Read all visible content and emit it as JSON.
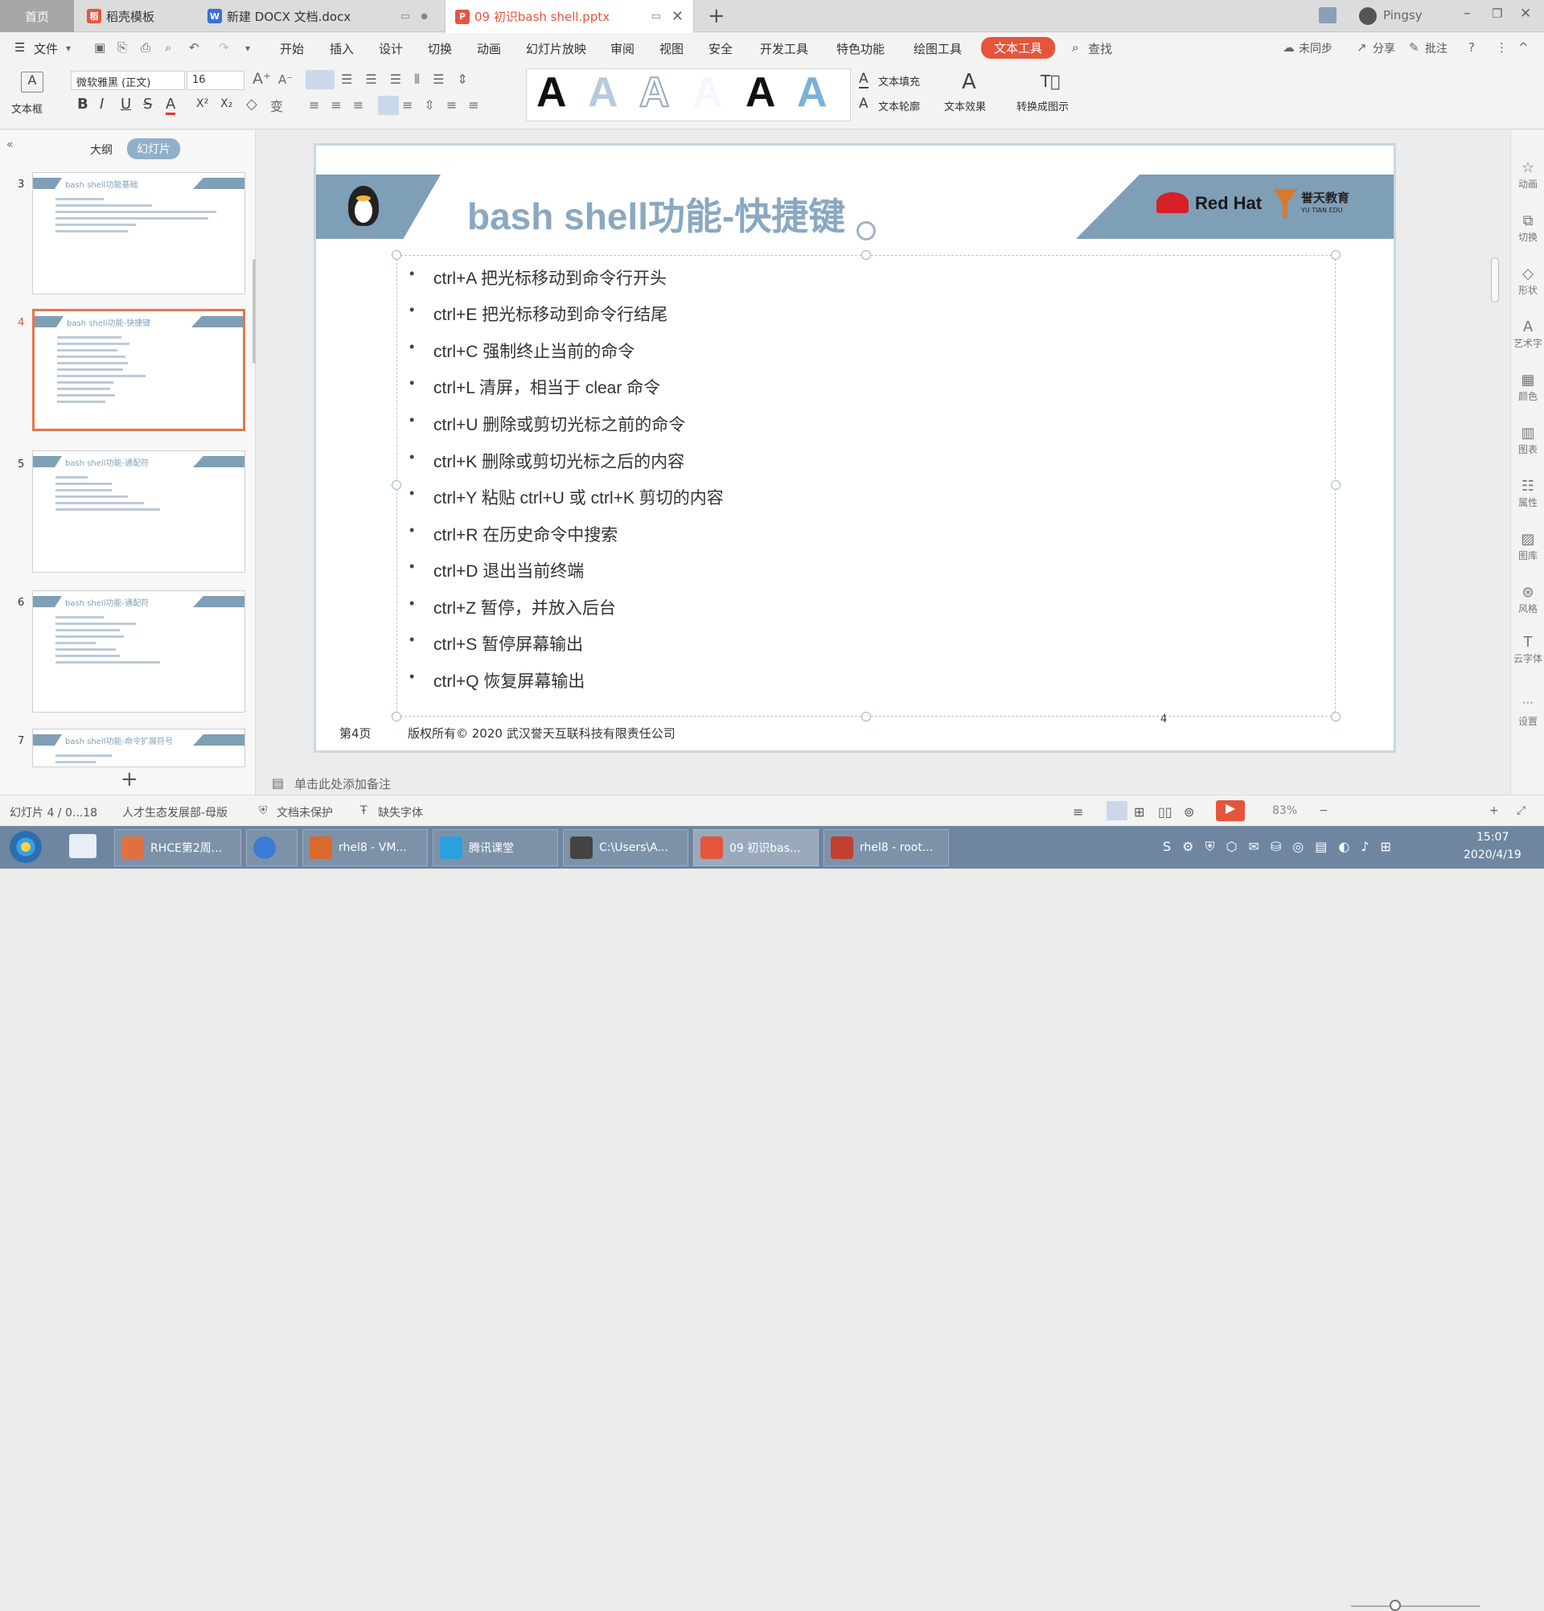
{
  "tabs": {
    "home": "首页",
    "items": [
      {
        "label": "稻壳模板",
        "color": "#e5553c",
        "icon": "docer-icon"
      },
      {
        "label": "新建 DOCX 文档.docx",
        "color": "#3a6fd8",
        "icon": "writer-icon"
      },
      {
        "label": "09 初识bash shell.pptx",
        "color": "#e5553c",
        "icon": "presentation-icon"
      }
    ],
    "user": "Pingsy"
  },
  "menu": {
    "file": "文件",
    "items": [
      "开始",
      "插入",
      "设计",
      "切换",
      "动画",
      "幻灯片放映",
      "审阅",
      "视图",
      "安全",
      "开发工具",
      "特色功能",
      "绘图工具"
    ],
    "active": "文本工具",
    "search": "查找",
    "right": [
      "未同步",
      "分享",
      "批注"
    ]
  },
  "ribbon": {
    "textbox": "文本框",
    "font_name": "微软雅黑 (正文)",
    "font_size": "16",
    "text_fill": "文本填充",
    "text_outline": "文本轮廓",
    "text_effect": "文本效果",
    "convert": "转换成图示",
    "style_letter": "A",
    "format_buttons": [
      "B",
      "I",
      "U",
      "S",
      "A",
      "X²",
      "X₂"
    ]
  },
  "leftpanel": {
    "outline_tab": "大纲",
    "slides_tab": "幻灯片",
    "thumbs": [
      {
        "num": "3",
        "title": "bash shell功能基础"
      },
      {
        "num": "4",
        "title": "bash shell功能-快捷键"
      },
      {
        "num": "5",
        "title": "bash shell功能-通配符"
      },
      {
        "num": "6",
        "title": "bash shell功能-通配符"
      },
      {
        "num": "7",
        "title": "bash shell功能-命令扩展符号"
      }
    ],
    "add": "+"
  },
  "slide": {
    "title": "bash shell功能-快捷键",
    "brand": "Red Hat",
    "partner": "誉天教育",
    "partner_en": "YU TIAN EDU",
    "bullets": [
      "ctrl+A 把光标移动到命令行开头",
      "ctrl+E 把光标移动到命令行结尾",
      "ctrl+C 强制终止当前的命令",
      "ctrl+L 清屏，相当于 clear 命令",
      "ctrl+U 删除或剪切光标之前的命令",
      "ctrl+K 删除或剪切光标之后的内容",
      "ctrl+Y 粘贴 ctrl+U 或 ctrl+K 剪切的内容",
      "ctrl+R 在历史命令中搜索",
      "ctrl+D 退出当前终端",
      "ctrl+Z 暂停，并放入后台",
      "ctrl+S 暂停屏幕输出",
      "ctrl+Q 恢复屏幕输出"
    ],
    "page_label": "第4页",
    "copyright": "版权所有© 2020 武汉誉天互联科技有限责任公司",
    "page_num": "4"
  },
  "notes_placeholder": "单击此处添加备注",
  "rightbar": [
    "动画",
    "切换",
    "形状",
    "艺术字",
    "颜色",
    "图表",
    "属性",
    "图库",
    "风格",
    "云字体",
    "设置"
  ],
  "status": {
    "slide_pos": "幻灯片 4 / 0...18",
    "template": "人才生态发展部-母版",
    "protect": "文档未保护",
    "font": "缺失字体",
    "zoom": "83%"
  },
  "taskbar": {
    "items": [
      {
        "label": "RHCE第2周...",
        "color": "#e07040"
      },
      {
        "label": "",
        "color": "#3a7bd5"
      },
      {
        "label": "rhel8 - VM...",
        "color": "#d96a2b"
      },
      {
        "label": "腾讯课堂",
        "color": "#2aa0e0"
      },
      {
        "label": "C:\\Users\\A...",
        "color": "#444"
      },
      {
        "label": "09 初识bas...",
        "color": "#e5553c"
      },
      {
        "label": "rhel8 - root...",
        "color": "#c04030"
      }
    ],
    "time": "15:07",
    "date": "2020/4/19"
  }
}
